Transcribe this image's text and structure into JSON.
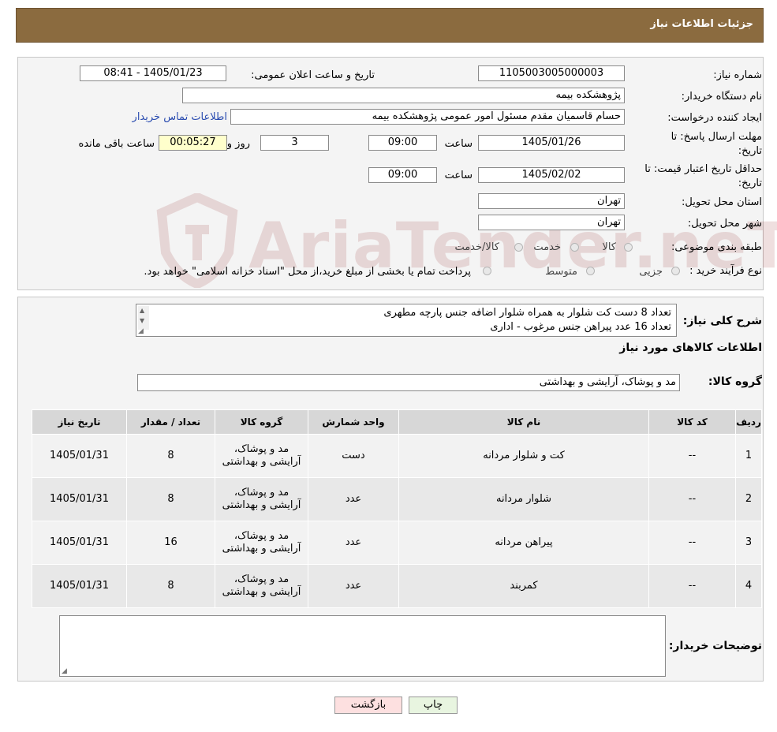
{
  "header": {
    "title": "جزئیات اطلاعات نیاز"
  },
  "form": {
    "need_number_label": "شماره نیاز:",
    "need_number": "1105003005000003",
    "announce_label": "تاریخ و ساعت اعلان عمومی:",
    "announce_value": "1405/01/23 - 08:41",
    "buyer_org_label": "نام دستگاه خریدار:",
    "buyer_org": "پژوهشکده بیمه",
    "creator_label": "ایجاد کننده درخواست:",
    "creator": "حسام قاسمیان مقدم مسئول امور عمومی پژوهشکده بیمه",
    "contact_link": "اطلاعات تماس خریدار",
    "deadline_label_1": "مهلت ارسال پاسخ: تا",
    "deadline_label_2": "تاریخ:",
    "deadline_date": "1405/01/26",
    "time_label": "ساعت",
    "deadline_time": "09:00",
    "days_value": "3",
    "days_label": "روز و",
    "remaining_time": "00:05:27",
    "remaining_label": "ساعت باقی مانده",
    "validity_label_1": "حداقل تاریخ اعتبار قیمت: تا",
    "validity_label_2": "تاریخ:",
    "validity_date": "1405/02/02",
    "validity_time": "09:00",
    "province_label": "استان محل تحویل:",
    "province": "تهران",
    "city_label": "شهر محل تحویل:",
    "city": "تهران",
    "category_label": "طبقه بندی موضوعی:",
    "category_options": [
      "کالا",
      "خدمت",
      "کالا/خدمت"
    ],
    "process_label": "نوع فرآیند خرید :",
    "process_options": [
      "جزیی",
      "متوسط"
    ],
    "process_note": "پرداخت تمام یا بخشی از مبلغ خرید،از محل \"اسناد خزانه اسلامی\" خواهد بود."
  },
  "summary": {
    "label": "شرح کلی نیاز:",
    "lines": [
      "تعداد 8 دست کت شلوار به همراه شلوار اضافه جنس پارچه مطهری",
      "تعداد 16 عدد پیراهن جنس مرغوب - اداری"
    ],
    "goods_info_title": "اطلاعات کالاهای مورد نیاز",
    "group_label": "گروه کالا:",
    "group_value": "مد و پوشاک، آرایشی و بهداشتی"
  },
  "table": {
    "headers": [
      "ردیف",
      "کد کالا",
      "نام کالا",
      "واحد شمارش",
      "گروه کالا",
      "تعداد / مقدار",
      "تاریخ نیاز"
    ],
    "rows": [
      [
        "1",
        "--",
        "کت و شلوار مردانه",
        "دست",
        "مد و پوشاک، آرایشی و بهداشتی",
        "8",
        "1405/01/31"
      ],
      [
        "2",
        "--",
        "شلوار مردانه",
        "عدد",
        "مد و پوشاک، آرایشی و بهداشتی",
        "8",
        "1405/01/31"
      ],
      [
        "3",
        "--",
        "پیراهن مردانه",
        "عدد",
        "مد و پوشاک، آرایشی و بهداشتی",
        "16",
        "1405/01/31"
      ],
      [
        "4",
        "--",
        "کمربند",
        "عدد",
        "مد و پوشاک، آرایشی و بهداشتی",
        "8",
        "1405/01/31"
      ]
    ]
  },
  "notes": {
    "label": "توضیحات خریدار:",
    "value": ""
  },
  "buttons": {
    "print": "چاپ",
    "back": "بازگشت"
  },
  "watermark": {
    "text": "AriaTender.neT"
  },
  "colors": {
    "header_bg": "#8b6b3f",
    "link": "#2a4cb0",
    "back_button": "#fde0e0",
    "print_button": "#e8f5e0"
  }
}
